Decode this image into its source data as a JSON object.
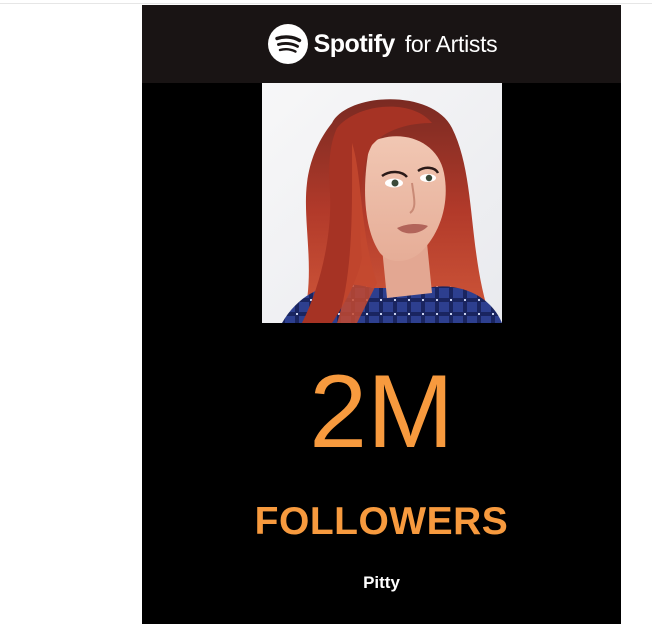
{
  "brand": {
    "logo_icon": "spotify-icon",
    "name": "Spotify",
    "suffix": "for Artists"
  },
  "artist": {
    "photo_icon": "artist-portrait-image",
    "name": "Pitty"
  },
  "stat": {
    "value": "2M",
    "label": "FOLLOWERS"
  },
  "colors": {
    "header_bg": "#191414",
    "card_bg": "#000000",
    "accent": "#f79a3e",
    "text": "#ffffff"
  }
}
